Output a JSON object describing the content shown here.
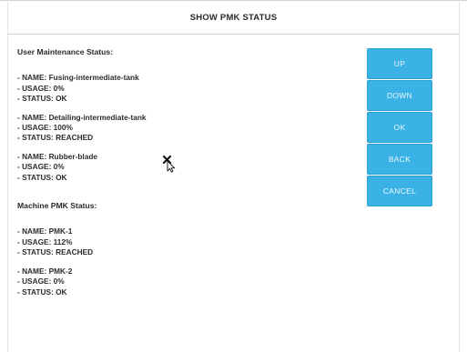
{
  "header": {
    "title": "SHOW PMK STATUS"
  },
  "user_maintenance": {
    "title": "User Maintenance Status:",
    "entries": [
      {
        "name": "- NAME: Fusing-intermediate-tank",
        "usage": "- USAGE: 0%",
        "status": "- STATUS: OK"
      },
      {
        "name": "- NAME: Detailing-intermediate-tank",
        "usage": "- USAGE: 100%",
        "status": "- STATUS: REACHED"
      },
      {
        "name": "- NAME: Rubber-blade",
        "usage": "- USAGE: 0%",
        "status": "- STATUS: OK"
      }
    ]
  },
  "machine_pmk": {
    "title": "Machine PMK Status:",
    "entries": [
      {
        "name": "- NAME: PMK-1",
        "usage": "- USAGE: 112%",
        "status": "- STATUS: REACHED"
      },
      {
        "name": "- NAME: PMK-2",
        "usage": "- USAGE: 0%",
        "status": "- STATUS: OK"
      }
    ]
  },
  "buttons": {
    "up": "UP",
    "down": "DOWN",
    "ok": "OK",
    "back": "BACK",
    "cancel": "CANCEL"
  },
  "colors": {
    "button_bg": "#3bb2e6",
    "button_text": "#eaf7ff"
  },
  "icons": {
    "cursor": "busy-pointer-icon"
  }
}
